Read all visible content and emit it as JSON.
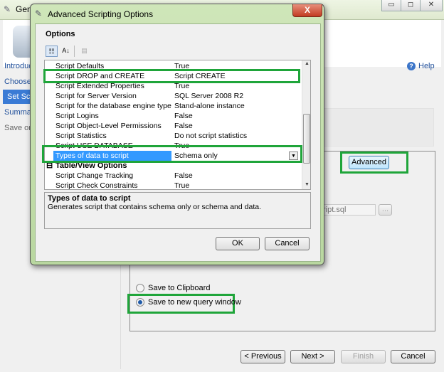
{
  "background_window": {
    "title": "Generate and Publish Scripts",
    "title_visible": "Gen",
    "controls": {
      "minimize": "▭",
      "maximize": "◻",
      "close": "✕"
    },
    "sidebar": [
      {
        "label": "Introduction",
        "visible": "Introduc"
      },
      {
        "label": "Choose Objects",
        "visible": "Choose"
      },
      {
        "label": "Set Scripting Options",
        "visible": "Set Scr"
      },
      {
        "label": "Summary",
        "visible": "Summar"
      },
      {
        "label": "Save or Publish Scripts",
        "visible": "Save or"
      }
    ],
    "help_label": "Help",
    "help_icon": "?",
    "advanced_label": "Advanced",
    "file_name_value": "script.sql",
    "file_name_visible": "script.sql",
    "browse_label": "...",
    "save_clipboard_label": "Save to Clipboard",
    "save_query_window_label": "Save to new query window",
    "buttons": {
      "previous": "< Previous",
      "next": "Next >",
      "finish": "Finish",
      "cancel": "Cancel"
    }
  },
  "dialog": {
    "title": "Advanced Scripting Options",
    "close_label": "X",
    "options_label": "Options",
    "toolbar": {
      "categorized": "☷",
      "alphabetical": "A↓",
      "pages": "▤"
    },
    "rows": [
      {
        "name": "Script Defaults",
        "value": "True"
      },
      {
        "name": "Script DROP and CREATE",
        "value": "Script CREATE"
      },
      {
        "name": "Script Extended Properties",
        "value": "True"
      },
      {
        "name": "Script for Server Version",
        "value": "SQL Server 2008 R2"
      },
      {
        "name": "Script for the database engine type",
        "value": "Stand-alone instance"
      },
      {
        "name": "Script Logins",
        "value": "False"
      },
      {
        "name": "Script Object-Level Permissions",
        "value": "False"
      },
      {
        "name": "Script Statistics",
        "value": "Do not script statistics"
      },
      {
        "name": "Script USE DATABASE",
        "value": "True"
      },
      {
        "name": "Types of data to script",
        "value": "Schema only"
      }
    ],
    "category": {
      "toggle": "⊟",
      "label": "Table/View Options"
    },
    "rows2": [
      {
        "name": "Script Change Tracking",
        "value": "False"
      },
      {
        "name": "Script Check Constraints",
        "value": "True"
      }
    ],
    "description": {
      "title": "Types of data to script",
      "text": "Generates script that contains schema only or schema and data."
    },
    "ok_label": "OK",
    "cancel_label": "Cancel"
  }
}
